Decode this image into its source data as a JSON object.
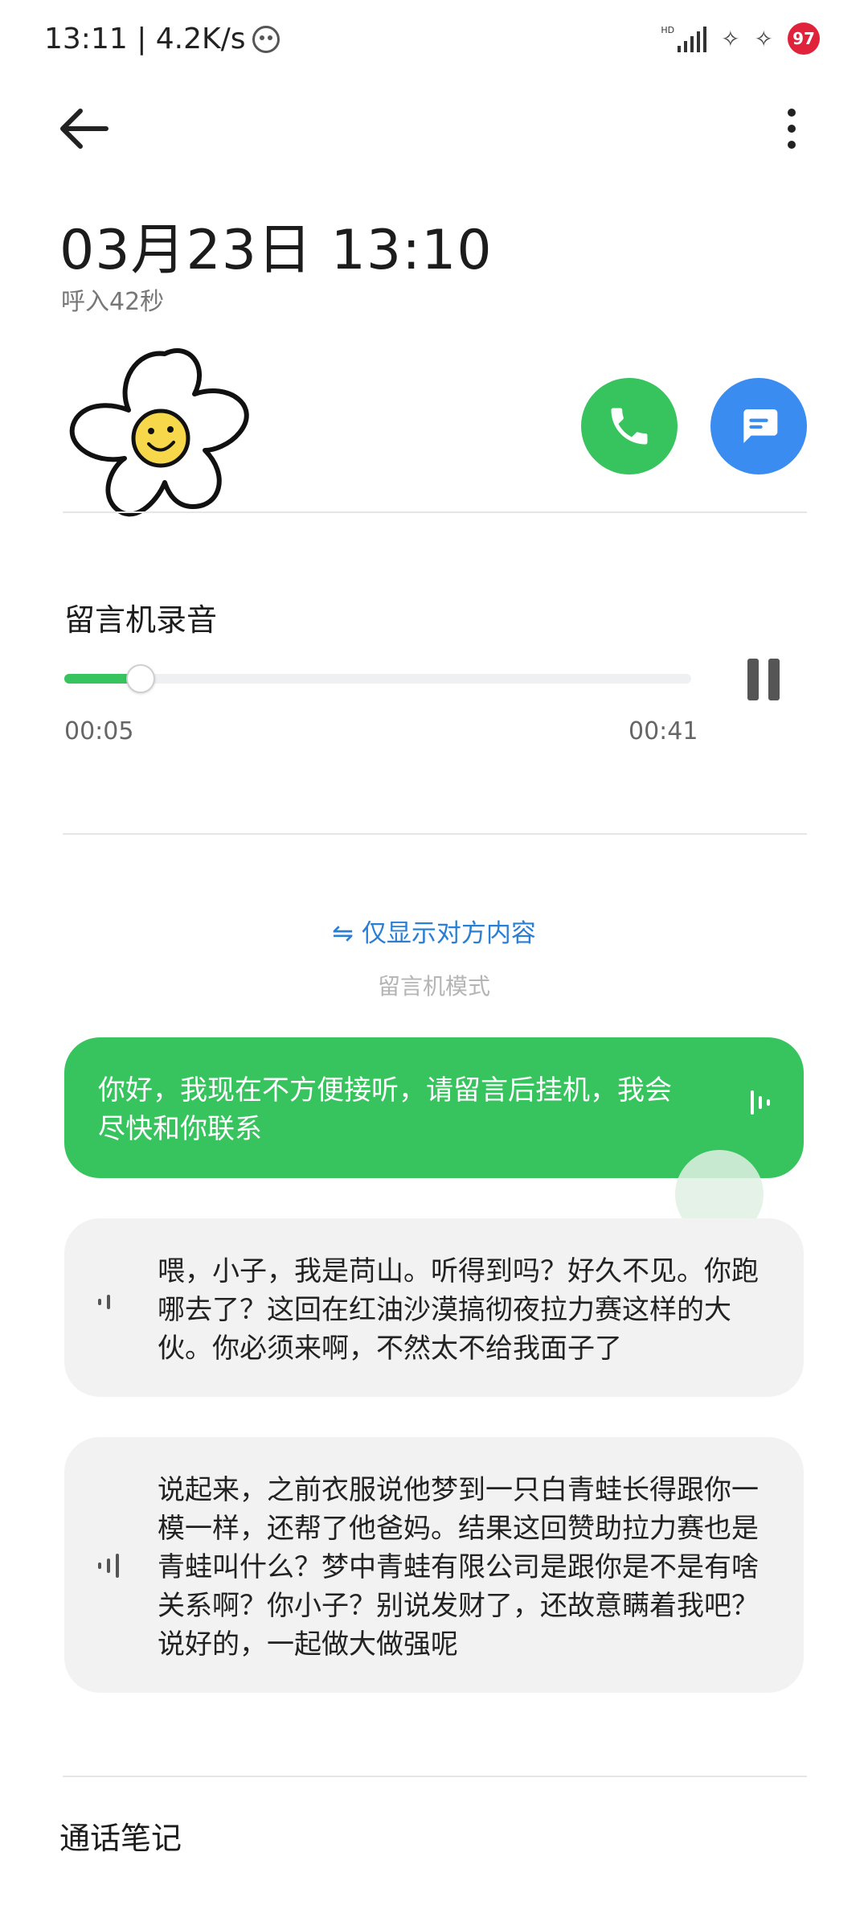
{
  "status_bar": {
    "time_speed": "13:11 | 4.2K/s",
    "network_label": "HD",
    "battery_level": "97",
    "battery_color": "#e0223a"
  },
  "top_bar": {
    "back_icon": "arrow-left-icon",
    "more_icon": "more-vertical-icon"
  },
  "call": {
    "datetime": "03月23日 13:10",
    "duration": "呼入42秒",
    "avatar_icon": "flower-smiley-avatar",
    "call_button_color": "#37c35e",
    "message_button_color": "#3b8cf0"
  },
  "recording": {
    "title": "留言机录音",
    "current_time": "00:05",
    "total_time": "00:41",
    "progress_fraction": 0.122,
    "accent": "#37c35e"
  },
  "mode": {
    "toggle_label": "仅显示对方内容",
    "mode_label": "留言机模式",
    "link_color": "#2a7fd4"
  },
  "messages": [
    {
      "side": "self",
      "text": "你好，我现在不方便接听，请留言后挂机，我会尽快和你联系"
    },
    {
      "side": "other",
      "text": "喂，小子，我是苘山。听得到吗？好久不见。你跑哪去了？这回在红油沙漠搞彻夜拉力赛这样的大伙。你必须来啊，不然太不给我面子了"
    },
    {
      "side": "other",
      "text": "说起来，之前衣服说他梦到一只白青蛙长得跟你一模一样，还帮了他爸妈。结果这回赞助拉力赛也是青蛙叫什么？梦中青蛙有限公司是跟你是不是有啥关系啊？你小子？别说发财了，还故意瞒着我吧？说好的，一起做大做强呢"
    }
  ],
  "notes": {
    "title": "通话笔记"
  }
}
